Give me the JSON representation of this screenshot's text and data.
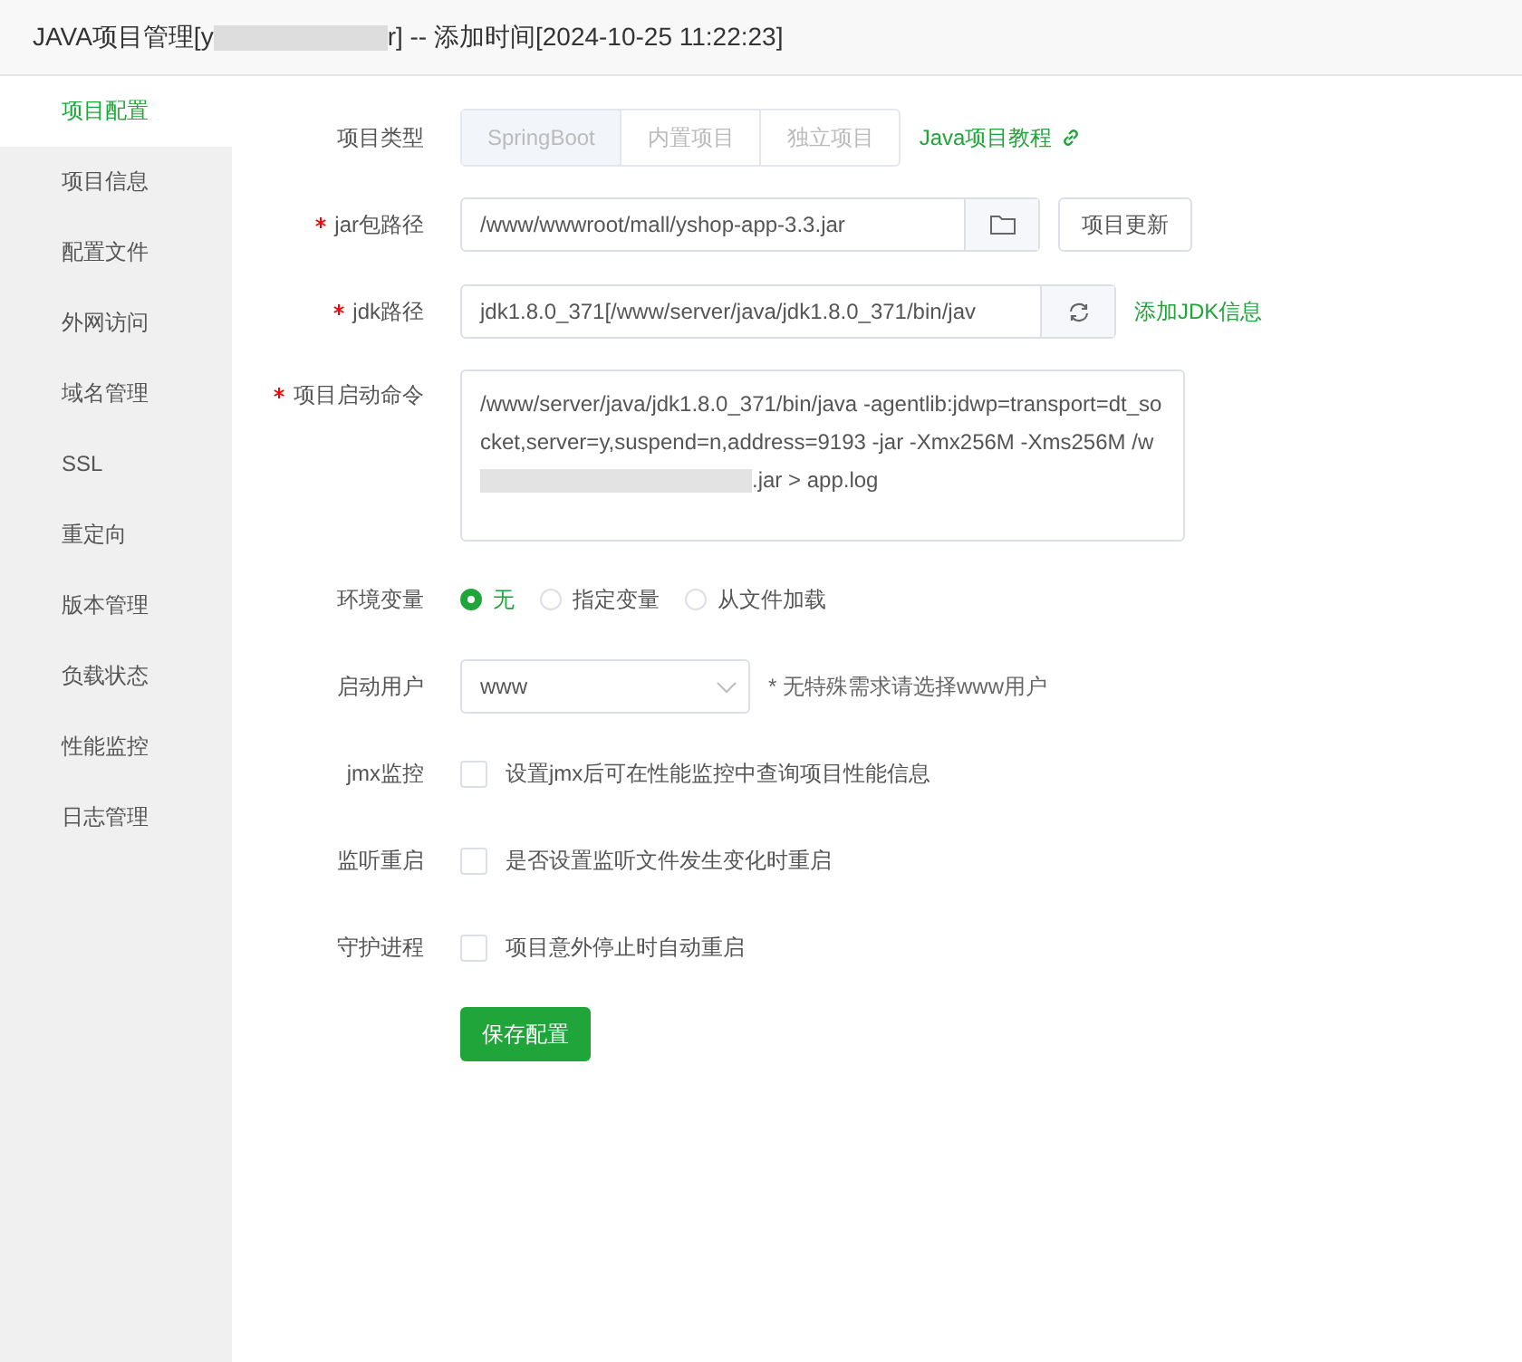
{
  "window": {
    "title_start": "JAVA项目管理[y",
    "title_end": "r] -- 添加时间[2024-10-25 11:22:23]"
  },
  "sidebar": {
    "items": [
      {
        "label": "项目配置",
        "selected": true
      },
      {
        "label": "项目信息",
        "selected": false
      },
      {
        "label": "配置文件",
        "selected": false
      },
      {
        "label": "外网访问",
        "selected": false
      },
      {
        "label": "域名管理",
        "selected": false
      },
      {
        "label": "SSL",
        "selected": false
      },
      {
        "label": "重定向",
        "selected": false
      },
      {
        "label": "版本管理",
        "selected": false
      },
      {
        "label": "负载状态",
        "selected": false
      },
      {
        "label": "性能监控",
        "selected": false
      },
      {
        "label": "日志管理",
        "selected": false
      }
    ]
  },
  "form": {
    "project_type": {
      "label": "项目类型",
      "options": [
        {
          "label": "SpringBoot",
          "selected": true
        },
        {
          "label": "内置项目",
          "selected": false
        },
        {
          "label": "独立项目",
          "selected": false
        }
      ],
      "link": "Java项目教程"
    },
    "jar_path": {
      "label": "jar包路径",
      "required": true,
      "value": "/www/wwwroot/mall/yshop-app-3.3.jar",
      "button": "项目更新"
    },
    "jdk_path": {
      "label": "jdk路径",
      "required": true,
      "value": "jdk1.8.0_371[/www/server/java/jdk1.8.0_371/bin/jav",
      "link": "添加JDK信息"
    },
    "command": {
      "label": "项目启动命令",
      "required": true,
      "value_start": "/www/server/java/jdk1.8.0_371/bin/java -agentlib:jdwp=transport=dt_socket,server=y,suspend=n,address=9193 -jar  -Xmx256M -Xms256M /w",
      "value_end": ".jar > app.log"
    },
    "env": {
      "label": "环境变量",
      "options": [
        {
          "label": "无",
          "selected": true
        },
        {
          "label": "指定变量",
          "selected": false
        },
        {
          "label": "从文件加载",
          "selected": false
        }
      ]
    },
    "user": {
      "label": "启动用户",
      "value": "www",
      "hint": "* 无特殊需求请选择www用户"
    },
    "checks": [
      {
        "label": "jmx监控",
        "text": "设置jmx后可在性能监控中查询项目性能信息",
        "checked": false
      },
      {
        "label": "监听重启",
        "text": "是否设置监听文件发生变化时重启",
        "checked": false
      },
      {
        "label": "守护进程",
        "text": "项目意外停止时自动重启",
        "checked": false
      }
    ],
    "save": "保存配置"
  }
}
